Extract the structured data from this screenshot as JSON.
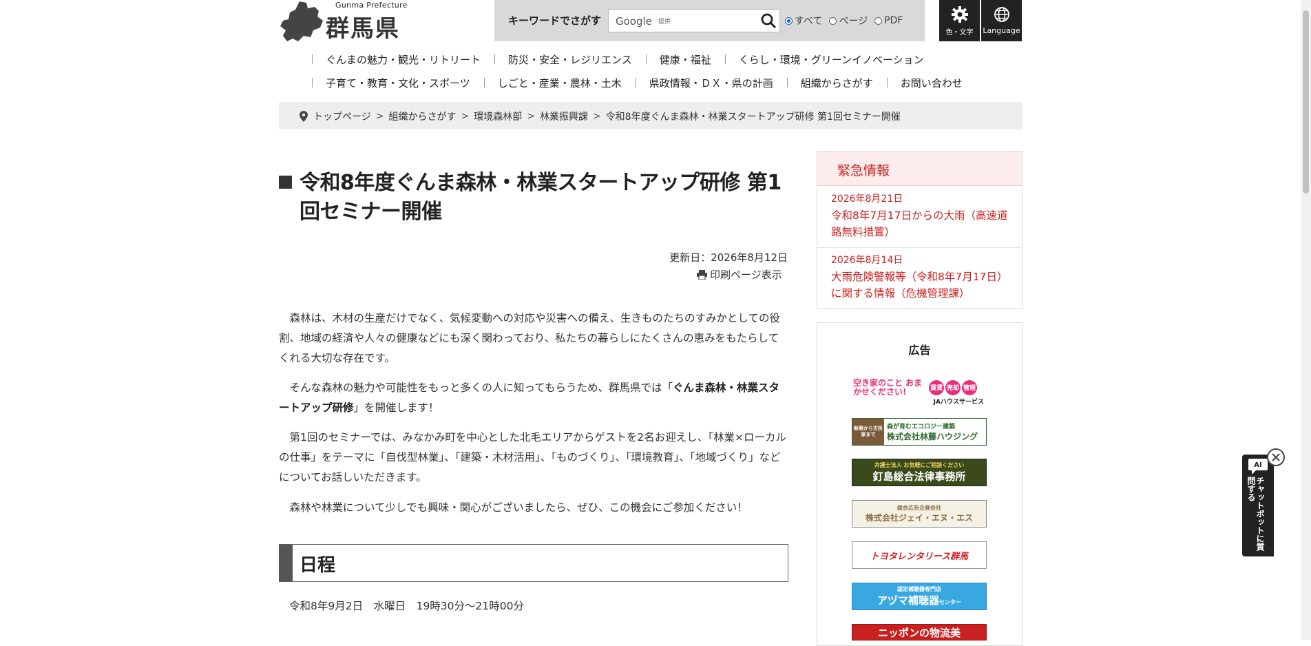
{
  "header": {
    "logo_sub": "Gunma Prefecture",
    "logo_text": "群馬県",
    "search_label": "キーワードでさがす",
    "search_placeholder": "Google",
    "google_sub": "提供",
    "radios": [
      {
        "label": "すべて",
        "checked": true
      },
      {
        "label": "ページ",
        "checked": false
      },
      {
        "label": "PDF",
        "checked": false
      }
    ],
    "color_text_label": "色・文字",
    "language_label": "Language"
  },
  "nav": {
    "row1": [
      "ぐんまの魅力・観光・リトリート",
      "防災・安全・レジリエンス",
      "健康・福祉",
      "くらし・環境・グリーンイノベーション"
    ],
    "row2": [
      "子育て・教育・文化・スポーツ",
      "しごと・産業・農林・土木",
      "県政情報・ＤＸ・県の計画",
      "組織からさがす",
      "お問い合わせ"
    ]
  },
  "breadcrumb": [
    "トップページ",
    "組織からさがす",
    "環境森林部",
    "林業振興課",
    "令和8年度ぐんま森林・林業スタートアップ研修 第1回セミナー開催"
  ],
  "main": {
    "title": "令和8年度ぐんま森林・林業スタートアップ研修 第1回セミナー開催",
    "updated": "更新日：2026年8月12日",
    "print_label": "印刷ページ表示",
    "p1": "森林は、木材の生産だけでなく、気候変動への対応や災害への備え、生きものたちのすみかとしての役割、地域の経済や人々の健康などにも深く関わっており、私たちの暮らしにたくさんの恵みをもたらしてくれる大切な存在です。",
    "p2_before": "そんな森林の魅力や可能性をもっと多くの人に知ってもらうため、群馬県では「",
    "p2_bold": "ぐんま森林・林業スタートアップ研修",
    "p2_after": "」を開催します！",
    "p3": "第1回のセミナーでは、みなかみ町を中心とした北毛エリアからゲストを2名お迎えし、「林業×ローカルの仕事」をテーマに「自伐型林業」、「建築・木材活用」、「ものづくり」、「環境教育」、「地域づくり」などについてお話しいただきます。",
    "p4": "森林や林業について少しでも興味・関心がございましたら、ぜひ、この機会にご参加ください！",
    "section_title": "日程",
    "schedule": "令和8年9月2日　水曜日　19時30分～21時00分"
  },
  "sidebar": {
    "emergency_title": "緊急情報",
    "emergency_items": [
      {
        "date": "2026年8月21日",
        "text": "令和8年7月17日からの大雨（高速道路無料措置）"
      },
      {
        "date": "2026年8月14日",
        "text": "大雨危険警報等（令和8年7月17日）に関する情報（危機管理課）"
      }
    ],
    "ads_title": "広告",
    "ads": [
      {
        "line1": "空き家のこと おまかせください!",
        "line2": "JAハウスサービス",
        "badges": [
          "賃貸",
          "売却",
          "管理"
        ]
      },
      {
        "line1": "森が育むエコロジー建築",
        "line2": "株式会社林藤ハウジング",
        "side": "新築から古民家まで"
      },
      {
        "line1": "弁護士法人 お気軽にご相談ください",
        "line2": "釘島総合法律事務所"
      },
      {
        "line1": "総合広告企画会社",
        "line2": "株式会社ジェイ・エヌ・エス"
      },
      {
        "line1": "トヨタレンタリース群馬"
      },
      {
        "line1": "認定補聴器専門店",
        "line2": "アヅマ補聴器",
        "line3": "センター"
      },
      {
        "line1": "ニッポンの物流美"
      }
    ]
  },
  "chatbot": {
    "ai_label": "AI",
    "text": "チャットボットに質問する"
  }
}
